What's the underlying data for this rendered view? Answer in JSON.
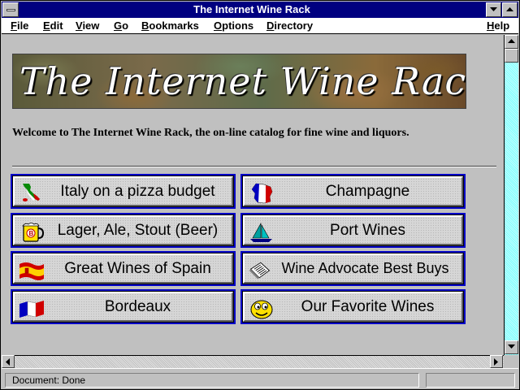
{
  "window": {
    "title": "The Internet Wine Rack"
  },
  "menu": {
    "items": [
      {
        "hot": "F",
        "rest": "ile"
      },
      {
        "hot": "E",
        "rest": "dit"
      },
      {
        "hot": "V",
        "rest": "iew"
      },
      {
        "hot": "G",
        "rest": "o"
      },
      {
        "hot": "B",
        "rest": "ookmarks"
      },
      {
        "hot": "O",
        "rest": "ptions"
      },
      {
        "hot": "D",
        "rest": "irectory"
      },
      {
        "hot": "H",
        "rest": "elp"
      }
    ]
  },
  "page": {
    "banner_text": "The Internet Wine Rack",
    "welcome": "Welcome to The Internet Wine Rack, the on-line catalog for fine wine and liquors."
  },
  "buttons": [
    {
      "label": "Italy on a pizza budget",
      "icon": "italy-map-icon"
    },
    {
      "label": "Champagne",
      "icon": "france-map-icon"
    },
    {
      "label": "Lager, Ale, Stout (Beer)",
      "icon": "beer-mug-icon"
    },
    {
      "label": "Port Wines",
      "icon": "sailboat-icon"
    },
    {
      "label": "Great Wines of Spain",
      "icon": "spain-flag-icon"
    },
    {
      "label": "Wine Advocate Best Buys",
      "icon": "newspaper-icon"
    },
    {
      "label": "Bordeaux",
      "icon": "french-flag-icon"
    },
    {
      "label": "Our Favorite Wines",
      "icon": "smiley-face-icon"
    }
  ],
  "status": {
    "text": "Document: Done"
  },
  "colors": {
    "titlebar": "#000080",
    "button_border": "#0000c8",
    "scrollbar": "#80ffff"
  }
}
